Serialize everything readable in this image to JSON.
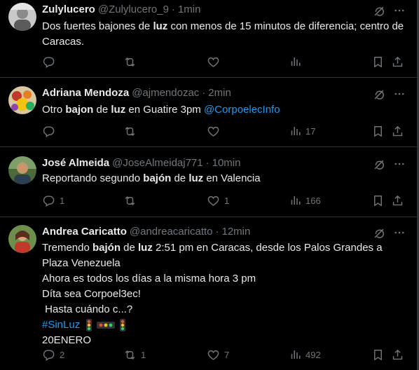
{
  "icons": {
    "grok": "grok-icon",
    "more": "more-icon",
    "reply": "reply-icon",
    "retweet": "retweet-icon",
    "like": "like-icon",
    "views": "views-icon",
    "bookmark": "bookmark-icon",
    "share": "share-icon"
  },
  "tweets": [
    {
      "name": "Zulylucero",
      "handle": "@Zulylucero_9",
      "sep": "·",
      "time": "1min",
      "text": {
        "t1": "Dos fuertes bajones de ",
        "b1": "luz",
        "t2": " con menos de 15 minutos de diferencia; centro de Caracas."
      },
      "counts": {
        "reply": "",
        "retweet": "",
        "like": "",
        "views": ""
      }
    },
    {
      "name": "Adriana Mendoza",
      "handle": "@ajmendozac",
      "sep": "·",
      "time": "2min",
      "text": {
        "t1": "Otro ",
        "b1": "bajon",
        "t2": " de ",
        "b2": "luz",
        "t3": " en Guatire 3pm ",
        "mention": "@CorpoelecInfo"
      },
      "counts": {
        "reply": "",
        "retweet": "",
        "like": "",
        "views": "17"
      }
    },
    {
      "name": "José Almeida",
      "handle": "@JoseAlmeidaj771",
      "sep": "·",
      "time": "10min",
      "text": {
        "t1": "Reportando segundo ",
        "b1": "bajón",
        "t2": " de ",
        "b2": "luz",
        "t3": " en Valencia"
      },
      "counts": {
        "reply": "1",
        "retweet": "",
        "like": "1",
        "views": "166"
      }
    },
    {
      "name": "Andrea Caricatto",
      "handle": "@andreacaricatto",
      "sep": "·",
      "time": "12min",
      "text": {
        "l1_t1": "Tremendo ",
        "l1_b1": "bajón",
        "l1_t2": " de ",
        "l1_b2": "luz",
        "l1_t3": " 2:51 pm en Caracas, desde los Palos Grandes a Plaza Venezuela",
        "l2": "Ahora es todos los días a la misma hora 3 pm",
        "l3": "Díta sea Corpoel3ec!",
        "l4": " Hasta cuándo c...?",
        "hashtag": "#SinLuz",
        "l6": "20ENERO"
      },
      "counts": {
        "reply": "2",
        "retweet": "1",
        "like": "7",
        "views": "492"
      }
    }
  ]
}
